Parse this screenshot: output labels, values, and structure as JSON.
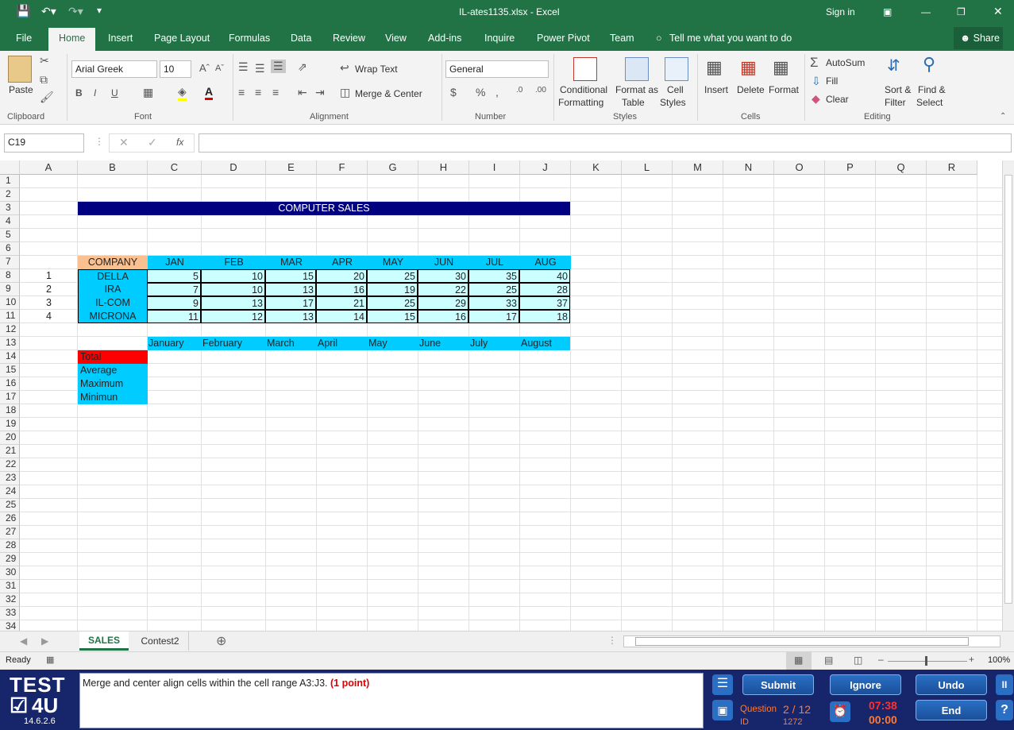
{
  "titlebar": {
    "filename": "IL-ates1135.xlsx  -  Excel",
    "signin": "Sign in"
  },
  "tabs": [
    "File",
    "Home",
    "Insert",
    "Page Layout",
    "Formulas",
    "Data",
    "Review",
    "View",
    "Add-ins",
    "Inquire",
    "Power Pivot",
    "Team"
  ],
  "tellme": "Tell me what you want to do",
  "share": "Share",
  "ribbon": {
    "paste": "Paste",
    "font_name": "Arial Greek",
    "font_size": "10",
    "wrap_text": "Wrap Text",
    "merge_center": "Merge & Center",
    "number_format": "General",
    "conditional": "Conditional",
    "formatting": "Formatting",
    "format_as": "Format as",
    "table": "Table",
    "cell": "Cell",
    "styles_btn": "Styles",
    "insert": "Insert",
    "delete": "Delete",
    "format": "Format",
    "autosum": "AutoSum",
    "fill": "Fill",
    "clear": "Clear",
    "sort1": "Sort &",
    "sort2": "Filter",
    "find1": "Find &",
    "find2": "Select",
    "groups": {
      "clipboard": "Clipboard",
      "font": "Font",
      "alignment": "Alignment",
      "number": "Number",
      "styles": "Styles",
      "cells": "Cells",
      "editing": "Editing"
    }
  },
  "namebox": "C19",
  "columns": [
    "A",
    "B",
    "C",
    "D",
    "E",
    "F",
    "G",
    "H",
    "I",
    "J",
    "K",
    "L",
    "M",
    "N",
    "O",
    "P",
    "Q",
    "R"
  ],
  "rows": [
    "1",
    "2",
    "3",
    "4",
    "5",
    "6",
    "7",
    "8",
    "9",
    "10",
    "11",
    "12",
    "13",
    "14",
    "15",
    "16",
    "17",
    "18",
    "19",
    "20",
    "21",
    "22",
    "23",
    "24",
    "25",
    "26",
    "27",
    "28",
    "29",
    "30",
    "31",
    "32",
    "33",
    "34"
  ],
  "sheet": {
    "title": "COMPUTER SALES",
    "company_header": "COMPANY",
    "month_abbr": [
      "JAN",
      "FEB",
      "MAR",
      "APR",
      "MAY",
      "JUN",
      "JUL",
      "AUG"
    ],
    "row_numbers": [
      "1",
      "2",
      "3",
      "4"
    ],
    "companies": [
      "DELLA",
      "IRA",
      "IL-COM",
      "MICRONA"
    ],
    "values": [
      [
        "5",
        "10",
        "15",
        "20",
        "25",
        "30",
        "35",
        "40"
      ],
      [
        "7",
        "10",
        "13",
        "16",
        "19",
        "22",
        "25",
        "28"
      ],
      [
        "9",
        "13",
        "17",
        "21",
        "25",
        "29",
        "33",
        "37"
      ],
      [
        "11",
        "12",
        "13",
        "14",
        "15",
        "16",
        "17",
        "18"
      ]
    ],
    "month_full": [
      "January",
      "February",
      "March",
      "April",
      "May",
      "June",
      "July",
      "August"
    ],
    "stats": [
      "Total",
      "Average",
      "Maximum",
      "Minimun"
    ]
  },
  "sheet_tabs": [
    "SALES",
    "Contest2"
  ],
  "status": {
    "ready": "Ready",
    "zoom": "100%"
  },
  "test": {
    "logo_top": "TEST",
    "logo_bottom": "4U",
    "version": "14.6.2.6",
    "question": "Merge and center align cells within the cell range A3:J3.",
    "points": "(1 point)",
    "submit": "Submit",
    "ignore": "Ignore",
    "undo": "Undo",
    "end": "End",
    "question_label": "Question",
    "question_num": "2 / 12",
    "id_label": "ID",
    "id_value": "1272",
    "timer": "07:38",
    "timer2": "00:00"
  },
  "colors": {
    "excel_green": "#217346",
    "title_fill": "#000080",
    "header_fill": "#00ccff",
    "company_fill": "#fac090",
    "data_fill": "#ccffff",
    "total_fill": "#ff0000"
  }
}
